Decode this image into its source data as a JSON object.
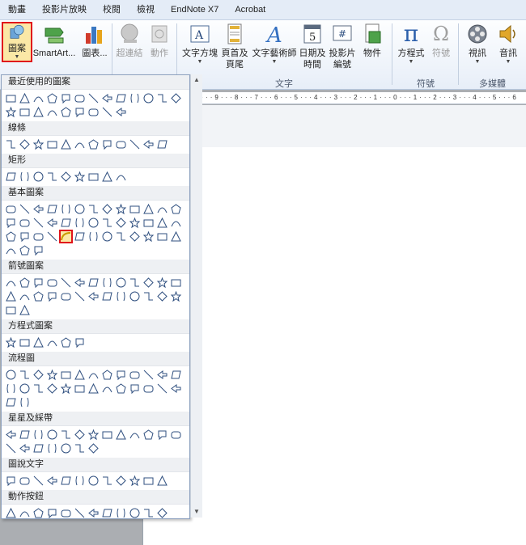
{
  "tabs": [
    "動畫",
    "投影片放映",
    "校閱",
    "檢視",
    "EndNote X7",
    "Acrobat"
  ],
  "ribbon": {
    "shapes_label": "圖案",
    "smartart_label": "SmartArt...",
    "chart_label": "圖表...",
    "hyperlink_label": "超連結",
    "action_label": "動作",
    "textbox_label": "文字方塊",
    "header_label_1": "頁首及",
    "header_label_2": "頁尾",
    "wordart_label": "文字藝術師",
    "datetime_label_1": "日期及",
    "datetime_label_2": "時間",
    "slidenum_label_1": "投影片",
    "slidenum_label_2": "編號",
    "object_label": "物件",
    "equation_label": "方程式",
    "symbol_label": "符號",
    "video_label": "視訊",
    "audio_label": "音訊",
    "groups": {
      "text": "文字",
      "symbols": "符號",
      "media": "多媒體"
    },
    "datetime_badge": "5",
    "slidenum_badge": "#",
    "pi": "π",
    "omega": "Ω",
    "wordart_glyph": "A"
  },
  "ruler_text": "10 · · · 9 · · · 8 · · · 7 · · · 6 · · · 5 · · · 4 · · · 3 · · · 2 · · · 1 · · · 0 · · · 1 · · · 2 · · · 3 · · · 4 · · · 5 · · · 6",
  "gallery": {
    "sections": [
      {
        "title": "最近使用的圖案",
        "count": 22,
        "selected": -1
      },
      {
        "title": "線條",
        "count": 12,
        "selected": -1
      },
      {
        "title": "矩形",
        "count": 9,
        "selected": -1
      },
      {
        "title": "基本圖案",
        "count": 42,
        "selected": 30
      },
      {
        "title": "箭號圖案",
        "count": 28,
        "selected": -1
      },
      {
        "title": "方程式圖案",
        "count": 6,
        "selected": -1
      },
      {
        "title": "流程圖",
        "count": 28,
        "selected": -1
      },
      {
        "title": "星星及綵帶",
        "count": 20,
        "selected": -1
      },
      {
        "title": "圖說文字",
        "count": 12,
        "selected": -1
      },
      {
        "title": "動作按鈕",
        "count": 12,
        "selected": -1
      }
    ]
  },
  "colors": {
    "accent_red": "#e0141b",
    "highlight": "#fbe8a6",
    "shape_stroke": "#2f4f7f"
  }
}
